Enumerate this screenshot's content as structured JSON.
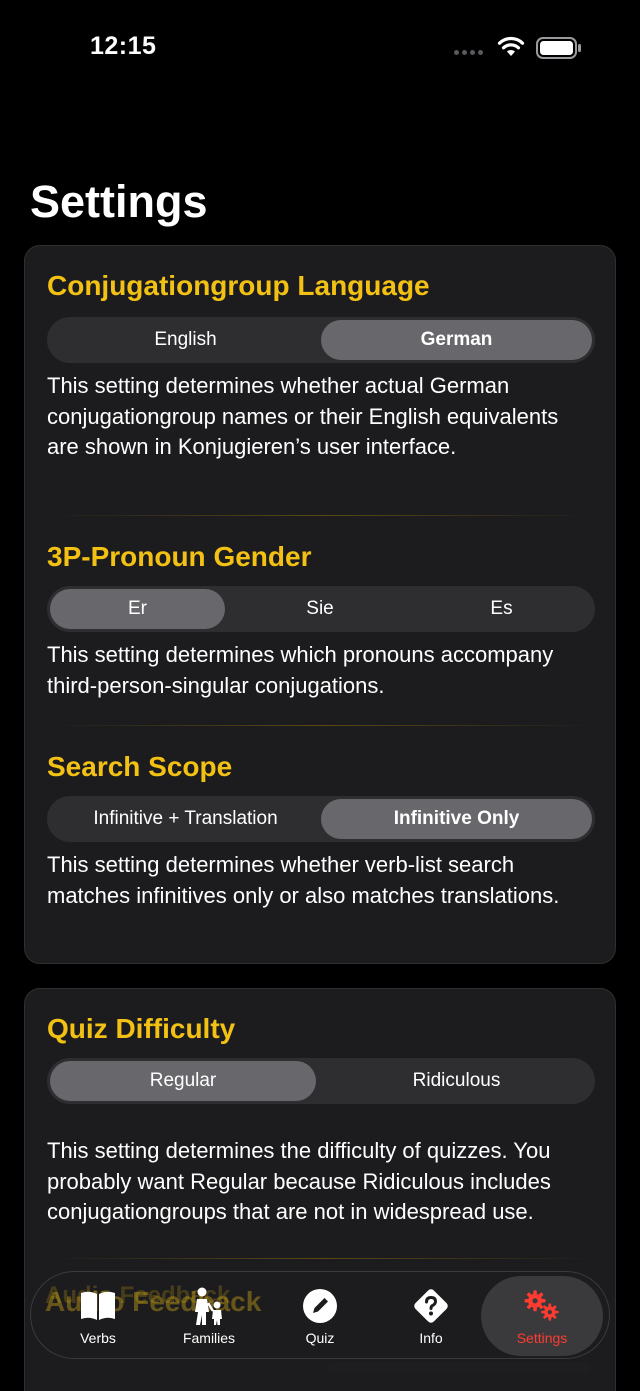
{
  "status_bar": {
    "time": "12:15"
  },
  "page": {
    "title": "Settings"
  },
  "colors": {
    "accent": "#f2c113",
    "active_tab": "#ff3b30",
    "card": "#1c1c1e",
    "segment_selected": "#67676c"
  },
  "settings": {
    "conjugation_language": {
      "title": "Conjugationgroup Language",
      "options": [
        "English",
        "German"
      ],
      "selected": "German",
      "description": "This setting determines whether actual German conjugationgroup names or their English equivalents are shown in Konjugieren’s user interface."
    },
    "pronoun_gender": {
      "title": "3P-Pronoun Gender",
      "options": [
        "Er",
        "Sie",
        "Es"
      ],
      "selected": "Er",
      "description": "This setting determines which pronouns accompany third-person-singular conjugations."
    },
    "search_scope": {
      "title": "Search Scope",
      "options": [
        "Infinitive + Translation",
        "Infinitive Only"
      ],
      "selected": "Infinitive Only",
      "description": "This setting determines whether verb-list search matches infinitives only or also matches translations."
    },
    "quiz_difficulty": {
      "title": "Quiz Difficulty",
      "options": [
        "Regular",
        "Ridiculous"
      ],
      "selected": "Regular",
      "description": "This setting determines the difficulty of quizzes. You probably want Regular because Ridiculous includes conjugationgroups that are not in widespread use."
    },
    "audio_feedback": {
      "title": "Audio Feedback"
    }
  },
  "tabbar": {
    "items": [
      {
        "label": "Verbs",
        "icon": "book-icon"
      },
      {
        "label": "Families",
        "icon": "family-icon"
      },
      {
        "label": "Quiz",
        "icon": "pencil-icon"
      },
      {
        "label": "Info",
        "icon": "question-icon"
      },
      {
        "label": "Settings",
        "icon": "gears-icon"
      }
    ],
    "active": "Settings"
  }
}
